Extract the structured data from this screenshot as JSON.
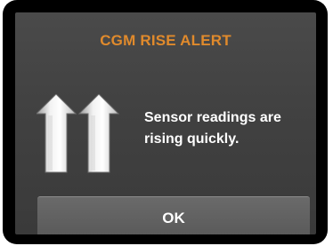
{
  "alert": {
    "title": "CGM RISE ALERT",
    "message_line1": "Sensor readings are",
    "message_line2": "rising quickly.",
    "icon": "double-up-arrow-icon",
    "ok_label": "OK"
  },
  "colors": {
    "title": "#e08a2c",
    "screen_background": "#444444",
    "button_background": "#606060",
    "text": "#ffffff"
  }
}
